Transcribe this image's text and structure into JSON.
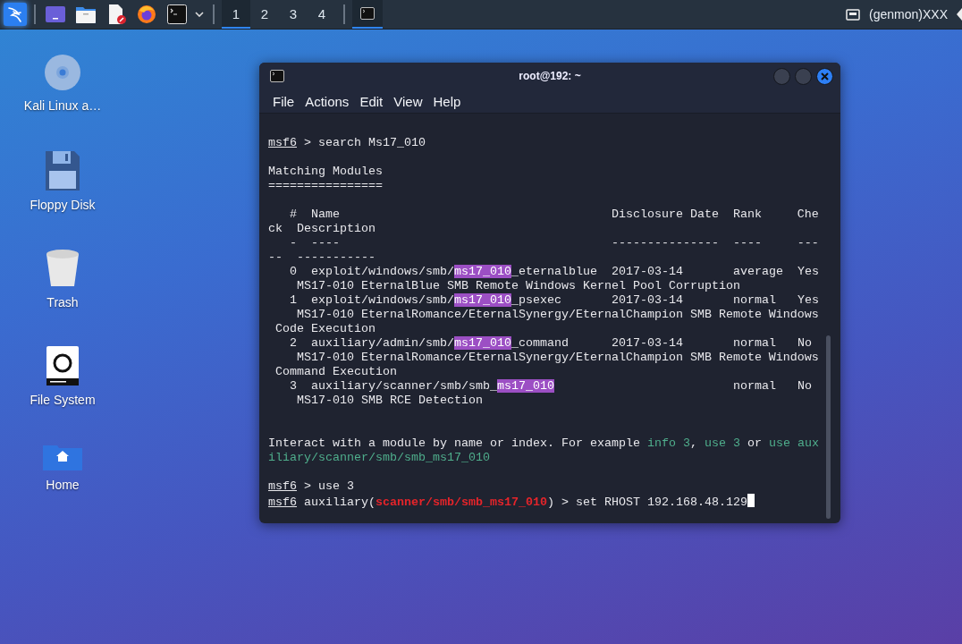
{
  "taskbar": {
    "workspaces": [
      {
        "label": "1",
        "selected": true
      },
      {
        "label": "2",
        "selected": false
      },
      {
        "label": "3",
        "selected": false
      },
      {
        "label": "4",
        "selected": false
      }
    ],
    "tasks": [
      {
        "selected": true
      }
    ],
    "genmon": "(genmon)XXX"
  },
  "desktop_icons": [
    {
      "label": "Kali Linux a…",
      "kind": "disc"
    },
    {
      "label": "Floppy Disk",
      "kind": "floppy"
    },
    {
      "label": "Trash",
      "kind": "trash"
    },
    {
      "label": "File System",
      "kind": "drive"
    },
    {
      "label": "Home",
      "kind": "home"
    }
  ],
  "terminal": {
    "title": "root@192: ~",
    "menu": [
      "File",
      "Actions",
      "Edit",
      "View",
      "Help"
    ],
    "blocks": [
      {
        "kind": "output",
        "lines": [
          [
            {
              "kind": "prompt",
              "text": "msf6"
            },
            {
              "kind": "text",
              "text": " > search Ms17_010"
            }
          ]
        ]
      },
      {
        "kind": "output",
        "lines": [
          [
            {
              "kind": "text",
              "text": "Matching Modules"
            }
          ],
          [
            {
              "kind": "text",
              "text": "================"
            }
          ]
        ]
      },
      {
        "kind": "output",
        "lines": [
          [
            {
              "kind": "text",
              "text": "   #  Name                                      Disclosure Date  Rank     Che"
            }
          ],
          [
            {
              "kind": "text",
              "text": "ck  Description"
            }
          ],
          [
            {
              "kind": "text",
              "text": "   -  ----                                      ---------------  ----     ---"
            }
          ],
          [
            {
              "kind": "text",
              "text": "--  -----------"
            }
          ],
          [
            {
              "kind": "text",
              "text": "   0  exploit/windows/smb/"
            },
            {
              "kind": "match",
              "text": "ms17_010"
            },
            {
              "kind": "text",
              "text": "_eternalblue  2017-03-14       average  Yes"
            }
          ],
          [
            {
              "kind": "text",
              "text": "    MS17-010 EternalBlue SMB Remote Windows Kernel Pool Corruption"
            }
          ],
          [
            {
              "kind": "text",
              "text": "   1  exploit/windows/smb/"
            },
            {
              "kind": "match",
              "text": "ms17_010"
            },
            {
              "kind": "text",
              "text": "_psexec       2017-03-14       normal   Yes"
            }
          ],
          [
            {
              "kind": "text",
              "text": "    MS17-010 EternalRomance/EternalSynergy/EternalChampion SMB Remote Windows"
            }
          ],
          [
            {
              "kind": "text",
              "text": " Code Execution"
            }
          ],
          [
            {
              "kind": "text",
              "text": "   2  auxiliary/admin/smb/"
            },
            {
              "kind": "match",
              "text": "ms17_010"
            },
            {
              "kind": "text",
              "text": "_command      2017-03-14       normal   No"
            }
          ],
          [
            {
              "kind": "text",
              "text": "    MS17-010 EternalRomance/EternalSynergy/EternalChampion SMB Remote Windows"
            }
          ],
          [
            {
              "kind": "text",
              "text": " Command Execution"
            }
          ],
          [
            {
              "kind": "text",
              "text": "   3  auxiliary/scanner/smb/smb_"
            },
            {
              "kind": "match",
              "text": "ms17_010"
            },
            {
              "kind": "text",
              "text": "                         normal   No"
            }
          ],
          [
            {
              "kind": "text",
              "text": "    MS17-010 SMB RCE Detection"
            }
          ]
        ]
      },
      {
        "kind": "notice",
        "lines": [
          [
            {
              "kind": "text",
              "text": "Interact with a module by name or index. For example "
            },
            {
              "kind": "hint",
              "text": "info 3"
            },
            {
              "kind": "text",
              "text": ", "
            },
            {
              "kind": "hint",
              "text": "use 3"
            },
            {
              "kind": "text",
              "text": " or "
            },
            {
              "kind": "hint",
              "text": "use aux"
            }
          ],
          [
            {
              "kind": "hint",
              "text": "iliary/scanner/smb/smb_ms17_010"
            }
          ]
        ]
      },
      {
        "kind": "output",
        "lines": [
          [
            {
              "kind": "prompt",
              "text": "msf6"
            },
            {
              "kind": "text",
              "text": " > use 3"
            }
          ],
          [
            {
              "kind": "prompt",
              "text": "msf6"
            },
            {
              "kind": "text",
              "text": " auxiliary("
            },
            {
              "kind": "module",
              "text": "scanner/smb/smb_ms17_010"
            },
            {
              "kind": "text",
              "text": ") > set RHOST 192.168.48.129"
            },
            {
              "kind": "cursor"
            }
          ]
        ]
      }
    ]
  }
}
